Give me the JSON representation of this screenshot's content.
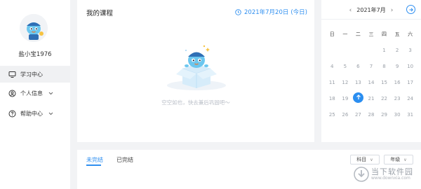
{
  "user": {
    "name": "盐小宝1976"
  },
  "nav": [
    {
      "label": "学习中心",
      "icon": "monitor-icon",
      "active": true
    },
    {
      "label": "个人信息",
      "icon": "user-icon"
    },
    {
      "label": "帮助中心",
      "icon": "help-icon"
    }
  ],
  "courses": {
    "title": "我的课程",
    "date": "2021年7月20日",
    "today": "(今日)",
    "empty_text": "空空如也，快去兼后巩固吧～"
  },
  "calendar": {
    "month": "2021年7月",
    "weekdays": [
      "日",
      "一",
      "二",
      "三",
      "四",
      "五",
      "六"
    ],
    "weeks": [
      [
        "",
        "",
        "",
        "",
        "1",
        "2",
        "3"
      ],
      [
        "4",
        "5",
        "6",
        "7",
        "8",
        "9",
        "10"
      ],
      [
        "11",
        "12",
        "13",
        "14",
        "15",
        "16",
        "17"
      ],
      [
        "18",
        "19",
        "20",
        "21",
        "22",
        "23",
        "24"
      ],
      [
        "25",
        "26",
        "27",
        "28",
        "29",
        "30",
        "31"
      ]
    ],
    "today_day": "20"
  },
  "bottom": {
    "tabs": [
      "未完结",
      "已完结"
    ],
    "subject_select": "科目",
    "grade_select": "年级"
  },
  "watermark": {
    "line1": "当下软件园",
    "line2": "www.downxia.com"
  },
  "colors": {
    "accent": "#2f8ff0",
    "background": "#f2f3f5"
  }
}
